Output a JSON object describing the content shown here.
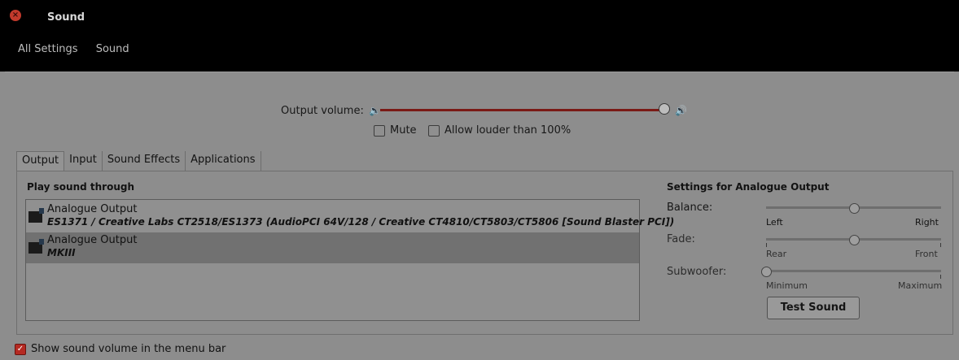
{
  "window": {
    "title": "Sound",
    "close_icon": "×"
  },
  "breadcrumb": [
    "All Settings",
    "Sound"
  ],
  "output_volume": {
    "label": "Output volume:",
    "level": 1.0,
    "low_icon": "🔈",
    "high_icon": "🔊",
    "mute_label": "Mute",
    "mute_checked": false,
    "allow_louder_label": "Allow louder than 100%",
    "allow_louder_checked": false
  },
  "tabs": [
    "Output",
    "Input",
    "Sound Effects",
    "Applications"
  ],
  "active_tab": "Output",
  "play_through": {
    "heading": "Play sound through",
    "devices": [
      {
        "name": "Analogue Output",
        "description": "ES1371 / Creative Labs CT2518/ES1373 (AudioPCI 64V/128 / Creative CT4810/CT5803/CT5806 [Sound Blaster PCI])",
        "selected": false
      },
      {
        "name": "Analogue Output",
        "description": "MKIII",
        "selected": true
      }
    ]
  },
  "settings": {
    "heading": "Settings for Analogue Output",
    "balance": {
      "label": "Balance:",
      "min_label": "Left",
      "max_label": "Right",
      "value": 0.5
    },
    "fade": {
      "label": "Fade:",
      "min_label": "Rear",
      "max_label": "Front",
      "value": 0.5
    },
    "subwoofer": {
      "label": "Subwoofer:",
      "min_label": "Minimum",
      "max_label": "Maximum",
      "value": 0.0
    },
    "test_button": "Test Sound"
  },
  "show_volume_in_menu_bar": {
    "label": "Show sound volume in the menu bar",
    "checked": true
  },
  "colors": {
    "titlebar": "#000000",
    "content_bg": "#8d8d8d",
    "accent": "#b52a22",
    "volume_track": "#7a1a16"
  }
}
